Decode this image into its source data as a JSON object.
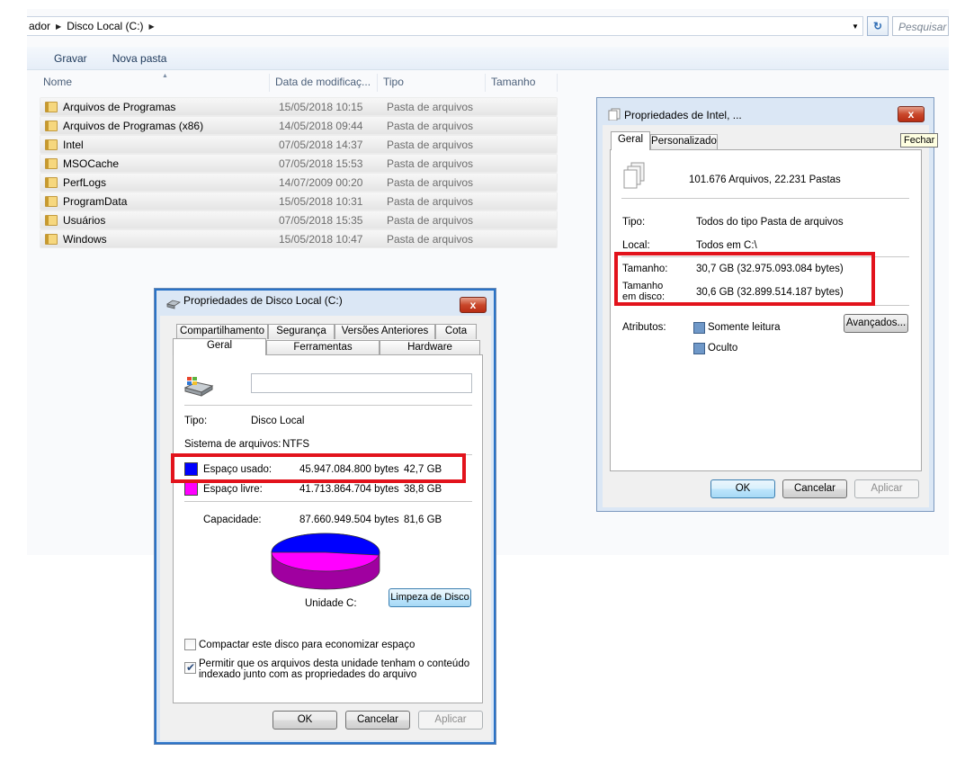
{
  "explorer": {
    "breadcrumb": [
      "ador",
      "Disco Local (C:)"
    ],
    "search_placeholder": "Pesquisar",
    "toolbar": {
      "gravar": "Gravar",
      "nova_pasta": "Nova pasta"
    },
    "columns": {
      "nome": "Nome",
      "data": "Data de modificaç...",
      "tipo": "Tipo",
      "tamanho": "Tamanho"
    },
    "files": [
      {
        "name": "Arquivos de Programas",
        "date": "15/05/2018 10:15",
        "type": "Pasta de arquivos"
      },
      {
        "name": "Arquivos de Programas (x86)",
        "date": "14/05/2018 09:44",
        "type": "Pasta de arquivos"
      },
      {
        "name": "Intel",
        "date": "07/05/2018 14:37",
        "type": "Pasta de arquivos"
      },
      {
        "name": "MSOCache",
        "date": "07/05/2018 15:53",
        "type": "Pasta de arquivos"
      },
      {
        "name": "PerfLogs",
        "date": "14/07/2009 00:20",
        "type": "Pasta de arquivos"
      },
      {
        "name": "ProgramData",
        "date": "15/05/2018 10:31",
        "type": "Pasta de arquivos"
      },
      {
        "name": "Usuários",
        "date": "07/05/2018 15:35",
        "type": "Pasta de arquivos"
      },
      {
        "name": "Windows",
        "date": "15/05/2018 10:47",
        "type": "Pasta de arquivos"
      }
    ]
  },
  "disk_dialog": {
    "title": "Propriedades de Disco Local (C:)",
    "close": "x",
    "tabs_top": [
      "Compartilhamento",
      "Segurança",
      "Versões Anteriores",
      "Cota"
    ],
    "tabs_bottom": [
      "Geral",
      "Ferramentas",
      "Hardware"
    ],
    "name_value": "",
    "tipo_label": "Tipo:",
    "tipo_value": "Disco Local",
    "fs_label": "Sistema de arquivos:",
    "fs_value": "NTFS",
    "used_label": "Espaço usado:",
    "used_bytes": "45.947.084.800 bytes",
    "used_gb": "42,7 GB",
    "free_label": "Espaço livre:",
    "free_bytes": "41.713.864.704 bytes",
    "free_gb": "38,8 GB",
    "cap_label": "Capacidade:",
    "cap_bytes": "87.660.949.504 bytes",
    "cap_gb": "81,6 GB",
    "drive_label": "Unidade C:",
    "cleanup_button": "Limpeza de Disco",
    "compress_label": "Compactar este disco para economizar espaço",
    "compress_checked": false,
    "index_label_1": "Permitir que os arquivos desta unidade tenham o conteúdo",
    "index_label_2": "indexado junto com as propriedades do arquivo",
    "index_checked": true,
    "ok": "OK",
    "cancel": "Cancelar",
    "apply": "Aplicar",
    "colors": {
      "used": "#0000ff",
      "free": "#ff00ff"
    },
    "used_fraction": 0.524
  },
  "intel_dialog": {
    "title": "Propriedades de Intel, ...",
    "close": "x",
    "tooltip": "Fechar",
    "tabs": [
      "Geral",
      "Personalizado"
    ],
    "contents": "101.676 Arquivos, 22.231 Pastas",
    "tipo_label": "Tipo:",
    "tipo_value": "Todos do tipo Pasta de arquivos",
    "local_label": "Local:",
    "local_value": "Todos em C:\\",
    "size_label": "Tamanho:",
    "size_value": "30,7 GB (32.975.093.084 bytes)",
    "disk_size_label_1": "Tamanho",
    "disk_size_label_2": "em disco:",
    "disk_size_value": "30,6 GB (32.899.514.187 bytes)",
    "attr_label": "Atributos:",
    "readonly_label": "Somente leitura",
    "hidden_label": "Oculto",
    "advanced_button": "Avançados...",
    "ok": "OK",
    "cancel": "Cancelar",
    "apply": "Aplicar"
  }
}
